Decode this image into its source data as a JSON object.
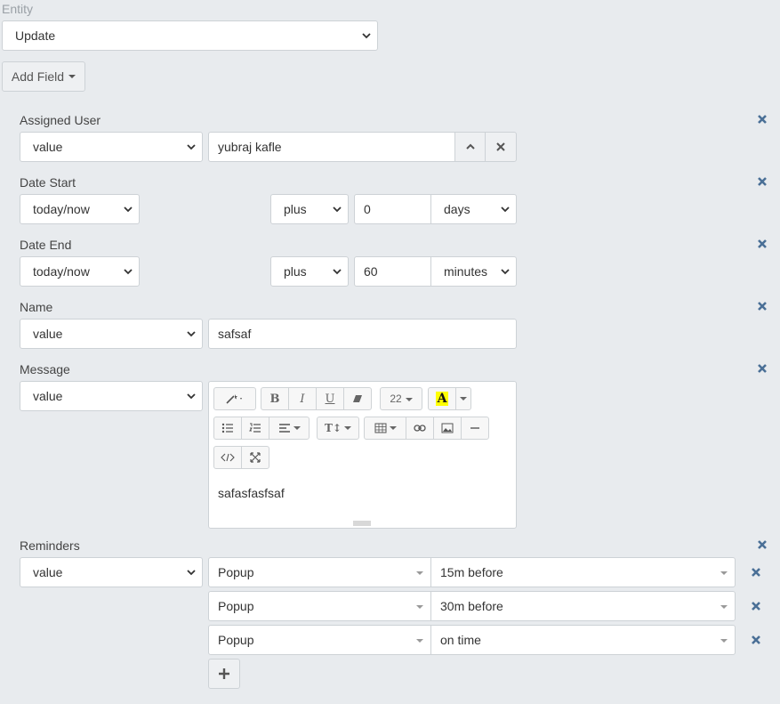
{
  "entity": {
    "label": "Entity",
    "value": "Update"
  },
  "add_field_label": "Add Field",
  "fields": {
    "assigned_user": {
      "label": "Assigned User",
      "type": "value",
      "value": "yubraj kafle"
    },
    "date_start": {
      "label": "Date Start",
      "base": "today/now",
      "op": "plus",
      "amount": "0",
      "unit": "days"
    },
    "date_end": {
      "label": "Date End",
      "base": "today/now",
      "op": "plus",
      "amount": "60",
      "unit": "minutes"
    },
    "name": {
      "label": "Name",
      "type": "value",
      "value": "safsaf"
    },
    "message": {
      "label": "Message",
      "type": "value",
      "font_size": "22",
      "content": "safasfasfsaf"
    },
    "reminders": {
      "label": "Reminders",
      "type": "value",
      "items": [
        {
          "type": "Popup",
          "time": "15m before"
        },
        {
          "type": "Popup",
          "time": "30m before"
        },
        {
          "type": "Popup",
          "time": "on time"
        }
      ]
    }
  },
  "colors": {
    "remove_icon": "#4a6f96",
    "highlight": "#ffff00"
  }
}
